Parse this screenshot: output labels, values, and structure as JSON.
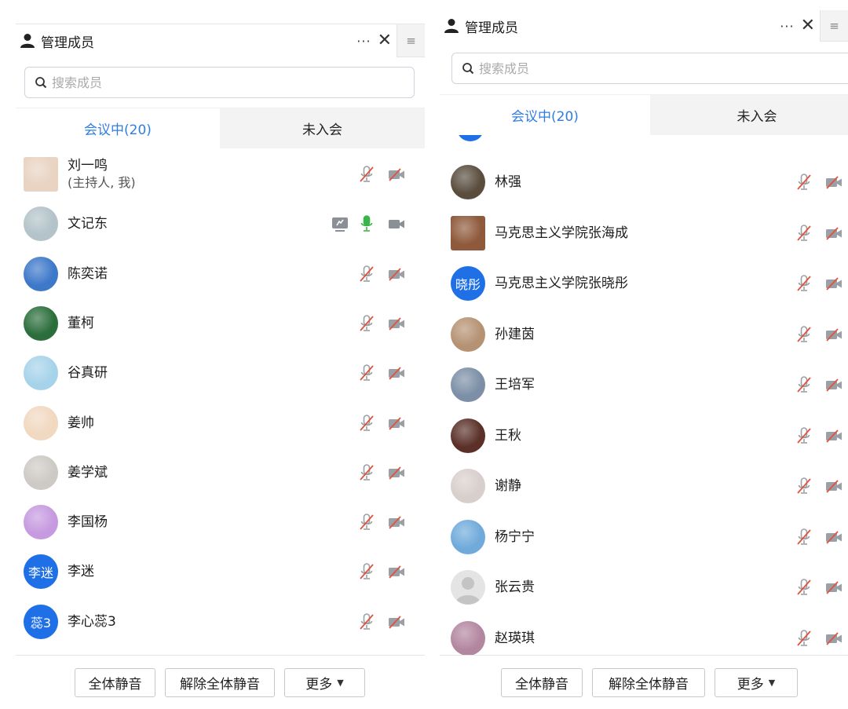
{
  "left": {
    "title": "管理成员",
    "more_label": "···",
    "close_label": "✕",
    "side_label": "≡",
    "search_placeholder": "搜索成员",
    "tabs": [
      {
        "label": "会议中(20)",
        "active": true
      },
      {
        "label": "未入会",
        "active": false
      }
    ],
    "members": [
      {
        "name": "刘一鸣",
        "role": "(主持人, 我)",
        "avatar": "picture",
        "bg": "#e9d3c2",
        "mic": "muted",
        "cam": "off",
        "share": false
      },
      {
        "name": "文记东",
        "role": "",
        "avatar": "photo",
        "bg": "#b3c3c9",
        "mic": "on",
        "cam": "on",
        "share": true
      },
      {
        "name": "陈奕诺",
        "role": "",
        "avatar": "photo",
        "bg": "#3d78c9",
        "mic": "muted",
        "cam": "off",
        "share": false
      },
      {
        "name": "董柯",
        "role": "",
        "avatar": "photo",
        "bg": "#2b6e3c",
        "mic": "muted",
        "cam": "off",
        "share": false
      },
      {
        "name": "谷真研",
        "role": "",
        "avatar": "photo",
        "bg": "#a6d3ea",
        "mic": "muted",
        "cam": "off",
        "share": false
      },
      {
        "name": "姜帅",
        "role": "",
        "avatar": "photo",
        "bg": "#f1d8c0",
        "mic": "muted",
        "cam": "off",
        "share": false
      },
      {
        "name": "姜学斌",
        "role": "",
        "avatar": "photo",
        "bg": "#cdcac5",
        "mic": "muted",
        "cam": "off",
        "share": false
      },
      {
        "name": "李国杨",
        "role": "",
        "avatar": "photo",
        "bg": "#c69ae0",
        "mic": "muted",
        "cam": "off",
        "share": false
      },
      {
        "name": "李迷",
        "role": "",
        "avatar": "text",
        "avatar_text": "李迷",
        "mic": "muted",
        "cam": "off",
        "share": false
      },
      {
        "name": "李心蕊3",
        "role": "",
        "avatar": "text",
        "avatar_text": "蕊3",
        "mic": "muted",
        "cam": "off",
        "share": false
      }
    ],
    "buttons": [
      {
        "label": "全体静音"
      },
      {
        "label": "解除全体静音"
      },
      {
        "label": "更多",
        "caret": "▼"
      }
    ]
  },
  "right": {
    "title": "管理成员",
    "more_label": "···",
    "close_label": "✕",
    "side_label": "≡",
    "search_placeholder": "搜索成员",
    "tabs": [
      {
        "label": "会议中(20)",
        "active": true
      },
      {
        "label": "未入会",
        "active": false
      }
    ],
    "members": [
      {
        "name": "林强",
        "role": "",
        "avatar": "photo",
        "bg": "#5a4d3e",
        "mic": "muted",
        "cam": "off",
        "share": false
      },
      {
        "name": "马克思主义学院张海成",
        "role": "",
        "avatar": "photo-square",
        "bg": "#8f5a3c",
        "mic": "muted",
        "cam": "off",
        "share": false
      },
      {
        "name": "马克思主义学院张晓彤",
        "role": "",
        "avatar": "text",
        "avatar_text": "晓彤",
        "mic": "muted",
        "cam": "off",
        "share": false
      },
      {
        "name": "孙建茵",
        "role": "",
        "avatar": "photo",
        "bg": "#b59273",
        "mic": "muted",
        "cam": "off",
        "share": false
      },
      {
        "name": "王培军",
        "role": "",
        "avatar": "photo",
        "bg": "#7c8fa6",
        "mic": "muted",
        "cam": "off",
        "share": false
      },
      {
        "name": "王秋",
        "role": "",
        "avatar": "photo",
        "bg": "#5a3028",
        "mic": "muted",
        "cam": "off",
        "share": false
      },
      {
        "name": "谢静",
        "role": "",
        "avatar": "photo",
        "bg": "#d8cfcc",
        "mic": "muted",
        "cam": "off",
        "share": false
      },
      {
        "name": "杨宁宁",
        "role": "",
        "avatar": "photo",
        "bg": "#6faadb",
        "mic": "muted",
        "cam": "off",
        "share": false
      },
      {
        "name": "张云贵",
        "role": "",
        "avatar": "default",
        "bg": "#e4e4e4",
        "mic": "muted",
        "cam": "off",
        "share": false
      },
      {
        "name": "赵瑛琪",
        "role": "",
        "avatar": "photo",
        "bg": "#b386a0",
        "mic": "muted",
        "cam": "off",
        "share": false
      }
    ],
    "buttons": [
      {
        "label": "全体静音"
      },
      {
        "label": "解除全体静音"
      },
      {
        "label": "更多",
        "caret": "▼"
      }
    ]
  }
}
